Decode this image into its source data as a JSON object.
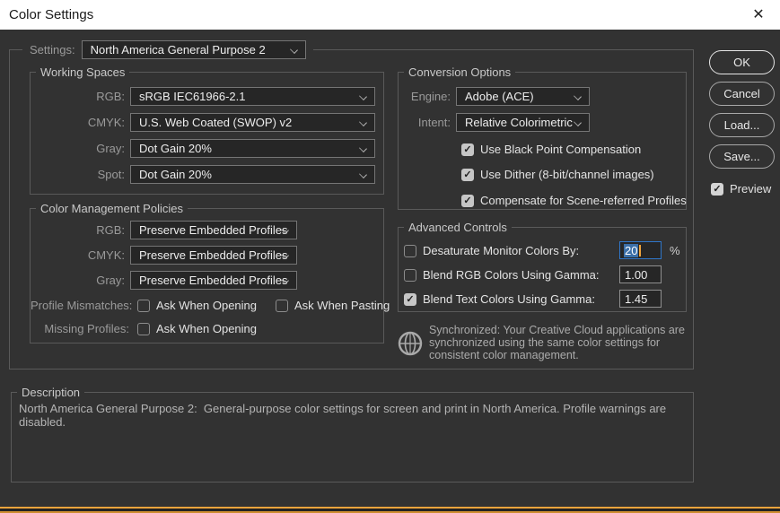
{
  "window": {
    "title": "Color Settings",
    "close_icon": "✕"
  },
  "icons": {
    "check": "✓",
    "chevron_down": "css-chevron-shape",
    "close": "✕",
    "sync_globe": "circle-crosshair-globe"
  },
  "colors": {
    "titlebar_bg": "#ffffff",
    "dialog_bg": "#323232",
    "group_border": "#5a5a5a",
    "accent_orange": "#f0a43c",
    "selection_blue": "#3c70a9",
    "focus_border": "#2f76c9"
  },
  "settings": {
    "label": "Settings:",
    "value": "North America General Purpose 2"
  },
  "working_spaces": {
    "title": "Working Spaces",
    "rows": [
      {
        "label": "RGB:",
        "value": "sRGB IEC61966-2.1"
      },
      {
        "label": "CMYK:",
        "value": "U.S. Web Coated (SWOP) v2"
      },
      {
        "label": "Gray:",
        "value": "Dot Gain 20%"
      },
      {
        "label": "Spot:",
        "value": "Dot Gain 20%"
      }
    ]
  },
  "color_management_policies": {
    "title": "Color Management Policies",
    "rows": [
      {
        "label": "RGB:",
        "value": "Preserve Embedded Profiles"
      },
      {
        "label": "CMYK:",
        "value": "Preserve Embedded Profiles"
      },
      {
        "label": "Gray:",
        "value": "Preserve Embedded Profiles"
      }
    ],
    "profile_mismatches": {
      "label": "Profile Mismatches:",
      "options": [
        {
          "label": "Ask When Opening",
          "checked": false
        },
        {
          "label": "Ask When Pasting",
          "checked": false
        }
      ]
    },
    "missing_profiles": {
      "label": "Missing Profiles:",
      "options": [
        {
          "label": "Ask When Opening",
          "checked": false
        }
      ]
    }
  },
  "conversion_options": {
    "title": "Conversion Options",
    "engine": {
      "label": "Engine:",
      "value": "Adobe (ACE)"
    },
    "intent": {
      "label": "Intent:",
      "value": "Relative Colorimetric"
    },
    "checkboxes": [
      {
        "label": "Use Black Point Compensation",
        "checked": true
      },
      {
        "label": "Use Dither (8-bit/channel images)",
        "checked": true
      },
      {
        "label": "Compensate for Scene-referred Profiles",
        "checked": true
      }
    ]
  },
  "advanced_controls": {
    "title": "Advanced Controls",
    "rows": [
      {
        "label": "Desaturate Monitor Colors By:",
        "checked": false,
        "value": "20",
        "suffix": "%",
        "value_selected": true
      },
      {
        "label": "Blend RGB Colors Using Gamma:",
        "checked": false,
        "value": "1.00"
      },
      {
        "label": "Blend Text Colors Using Gamma:",
        "checked": true,
        "value": "1.45"
      }
    ]
  },
  "sync_message": {
    "text": "Synchronized: Your Creative Cloud applications are synchronized using the same color settings for consistent color management."
  },
  "description": {
    "title": "Description",
    "text": "North America General Purpose 2:  General-purpose color settings for screen and print in North America. Profile warnings are disabled."
  },
  "buttons": {
    "ok": "OK",
    "cancel": "Cancel",
    "load": "Load...",
    "save": "Save...",
    "preview": {
      "label": "Preview",
      "checked": true
    }
  }
}
